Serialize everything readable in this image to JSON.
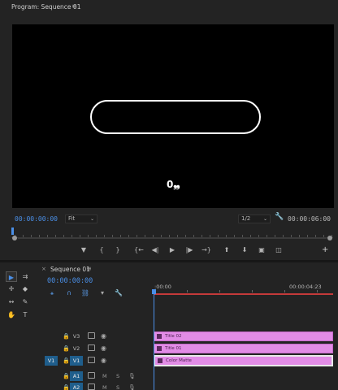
{
  "program_monitor": {
    "title": "Program: Sequence 01",
    "menu_icon": "hamburger-menu-icon",
    "overlay_text": "0❠",
    "timecode_current": "00:00:00:00",
    "zoom": "Fit",
    "resolution": "1/2",
    "timecode_duration": "00:00:06:00"
  },
  "transport": {
    "mark_in": "▾",
    "mark_out": "{",
    "mark_out2": "}",
    "go_in": "{←",
    "step_back": "◀│",
    "play": "▶",
    "step_forward": "│▶",
    "go_out": "→}",
    "lift": "⬆",
    "extract": "⬇",
    "export_frame": "▣",
    "compare": "▢",
    "add": "+"
  },
  "timeline": {
    "close_label": "×",
    "title": "Sequence 01",
    "menu_icon": "hamburger-menu-icon",
    "timecode": "00:00:00:00",
    "ruler_start": ":00:00",
    "ruler_end": "00:00:04:23"
  },
  "tracks": [
    {
      "name": "V3",
      "src": "",
      "clip": "Title 02"
    },
    {
      "name": "V2",
      "src": "",
      "clip": "Title 01"
    },
    {
      "name": "V1",
      "src": "V1",
      "clip": "Color Matte"
    },
    {
      "name": "A1",
      "src": "",
      "m": "M",
      "s": "S"
    },
    {
      "name": "A2",
      "src": "",
      "m": "M",
      "s": "S"
    }
  ],
  "colors": {
    "accent_blue": "#4a8fe7",
    "clip_pink": "#e28ce6",
    "work_area_red": "#c43a3a",
    "track_active": "#1f5e8c"
  }
}
